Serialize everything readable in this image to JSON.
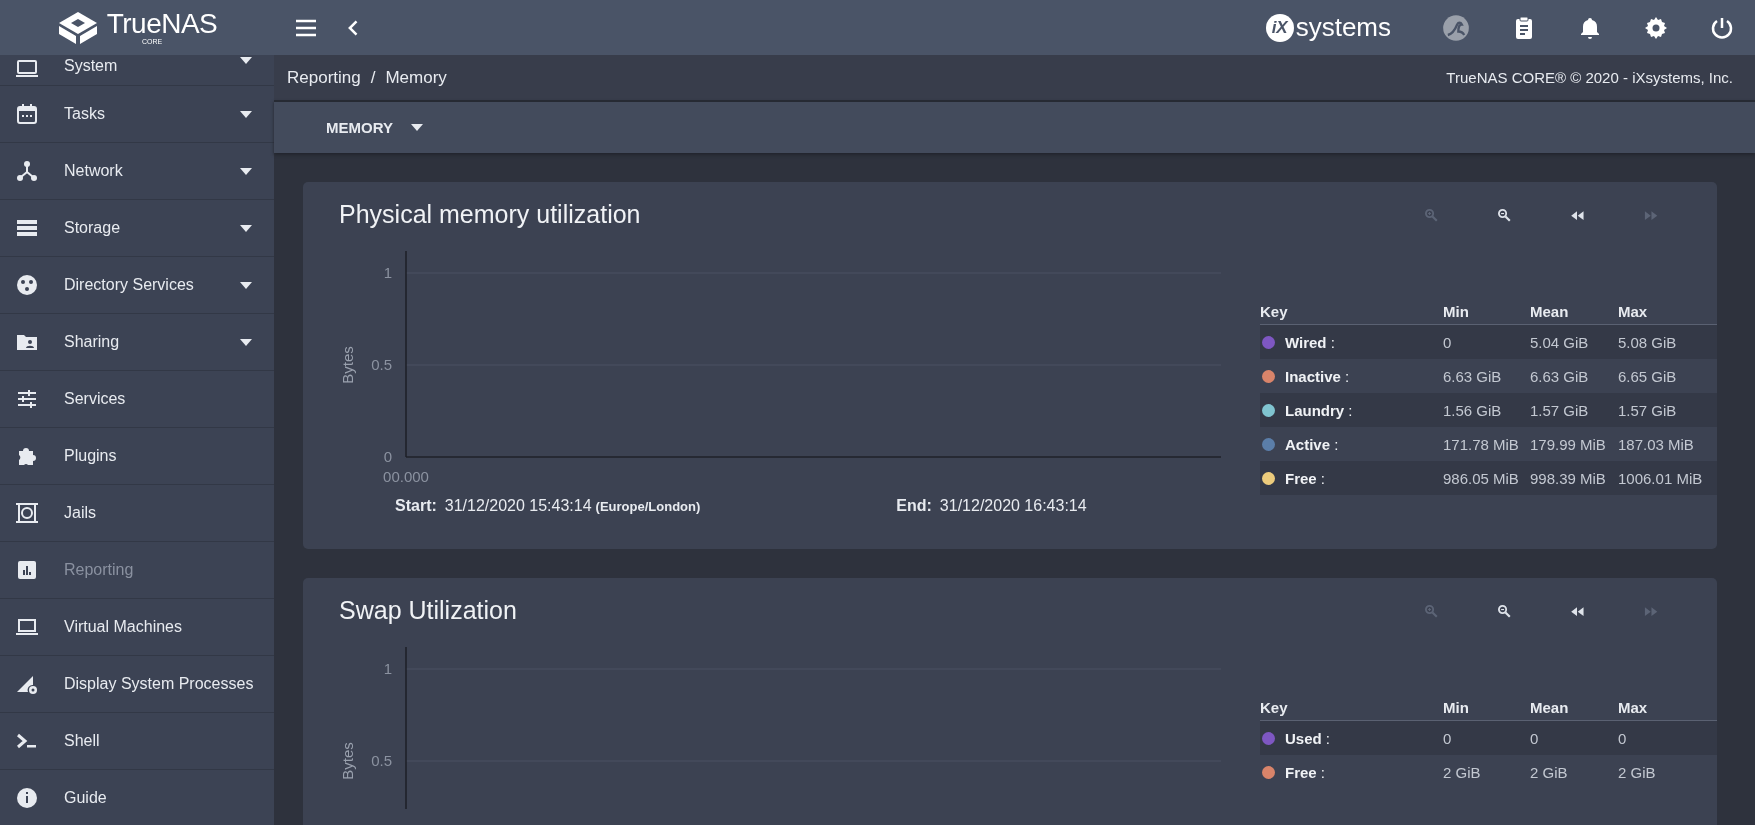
{
  "topbar": {
    "brand": "TrueNAS",
    "edition": "CORE",
    "vendor_mark": "iX",
    "vendor_name": "systems"
  },
  "sidebar": {
    "items": [
      {
        "label": "System",
        "expandable": true,
        "selected": false
      },
      {
        "label": "Tasks",
        "expandable": true,
        "selected": false
      },
      {
        "label": "Network",
        "expandable": true,
        "selected": false
      },
      {
        "label": "Storage",
        "expandable": true,
        "selected": false
      },
      {
        "label": "Directory Services",
        "expandable": true,
        "selected": false
      },
      {
        "label": "Sharing",
        "expandable": true,
        "selected": false
      },
      {
        "label": "Services",
        "expandable": false,
        "selected": false
      },
      {
        "label": "Plugins",
        "expandable": false,
        "selected": false
      },
      {
        "label": "Jails",
        "expandable": false,
        "selected": false
      },
      {
        "label": "Reporting",
        "expandable": false,
        "selected": true
      },
      {
        "label": "Virtual Machines",
        "expandable": false,
        "selected": false
      },
      {
        "label": "Display System Processes",
        "expandable": false,
        "selected": false
      },
      {
        "label": "Shell",
        "expandable": false,
        "selected": false
      },
      {
        "label": "Guide",
        "expandable": false,
        "selected": false
      }
    ]
  },
  "breadcrumb": {
    "items": [
      "Reporting",
      "Memory"
    ],
    "separator": "/"
  },
  "copyright": "TrueNAS CORE® © 2020 - iXsystems, Inc.",
  "report_menu": {
    "label": "MEMORY"
  },
  "cards": [
    {
      "title": "Physical memory utilization",
      "controls": [
        {
          "kind": "zoom_in",
          "disabled": true
        },
        {
          "kind": "zoom_out",
          "disabled": false
        },
        {
          "kind": "rewind",
          "disabled": false
        },
        {
          "kind": "fast_forward",
          "disabled": true
        }
      ],
      "plot": {
        "y_title": "Bytes",
        "y_ticks": [
          "1",
          "0.5",
          "0"
        ],
        "x_ticks": [
          "00.000"
        ]
      },
      "start_label": "Start:",
      "start": "31/12/2020 15:43:14",
      "timezone": "(Europe/London)",
      "end_label": "End:",
      "end": "31/12/2020 16:43:14",
      "legend": {
        "columns": [
          "Key",
          "Min",
          "Mean",
          "Max"
        ],
        "rows": [
          {
            "name": "**Wired** :",
            "color": "#7e57c2",
            "min": "0",
            "mean": "5.04 GiB",
            "max": "5.08 GiB"
          },
          {
            "name": "**Inactive** :",
            "color": "#d9846a",
            "min": "6.63 GiB",
            "mean": "6.63 GiB",
            "max": "6.65 GiB"
          },
          {
            "name": "**Laundry** :",
            "color": "#80c4d0",
            "min": "1.56 GiB",
            "mean": "1.57 GiB",
            "max": "1.57 GiB"
          },
          {
            "name": "**Active** :",
            "color": "#5b7ea9",
            "min": "171.78 MiB",
            "mean": "179.99 MiB",
            "max": "187.03 MiB"
          },
          {
            "name": "**Free** :",
            "color": "#eccb7c",
            "min": "986.05 MiB",
            "mean": "998.39 MiB",
            "max": "1006.01 MiB"
          }
        ]
      }
    },
    {
      "title": "Swap Utilization",
      "controls": [
        {
          "kind": "zoom_in",
          "disabled": true
        },
        {
          "kind": "zoom_out",
          "disabled": false
        },
        {
          "kind": "rewind",
          "disabled": false
        },
        {
          "kind": "fast_forward",
          "disabled": true
        }
      ],
      "plot": {
        "y_title": "Bytes",
        "y_ticks": [
          "1",
          "0.5"
        ]
      },
      "legend": {
        "columns": [
          "Key",
          "Min",
          "Mean",
          "Max"
        ],
        "rows": [
          {
            "name": "**Used** :",
            "color": "#7e57c2",
            "min": "0",
            "mean": "0",
            "max": "0"
          },
          {
            "name": "**Free** :",
            "color": "#d9846a",
            "min": "2 GiB",
            "mean": "2 GiB",
            "max": "2 GiB"
          }
        ]
      }
    }
  ]
}
